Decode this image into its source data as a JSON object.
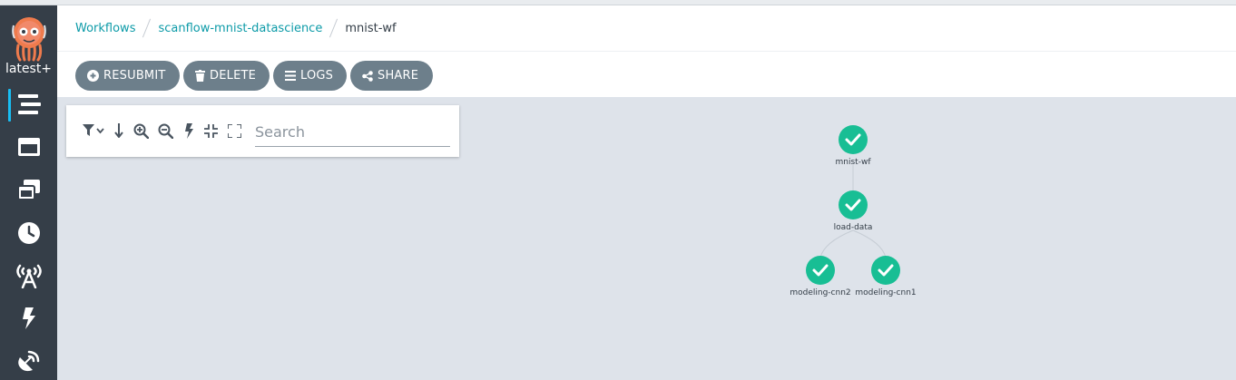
{
  "app": {
    "version": "latest+"
  },
  "sidebar": {
    "items": [
      {
        "name": "workflows",
        "icon": "stream-icon",
        "active": true
      },
      {
        "name": "workflow-templates",
        "icon": "window-maximize-icon"
      },
      {
        "name": "cluster-workflow-templates",
        "icon": "window-restore-icon"
      },
      {
        "name": "cron-workflows",
        "icon": "clock-icon"
      },
      {
        "name": "event-sources",
        "icon": "broadcast-tower-icon"
      },
      {
        "name": "sensors",
        "icon": "bolt-icon"
      },
      {
        "name": "event-flow",
        "icon": "satellite-dish-icon"
      }
    ],
    "accent": "#18bef3"
  },
  "breadcrumb": {
    "items": [
      "Workflows",
      "scanflow-mnist-datascience"
    ],
    "current": "mnist-wf"
  },
  "actions": {
    "resubmit": "RESUBMIT",
    "delete": "DELETE",
    "logs": "LOGS",
    "share": "SHARE"
  },
  "toolbar": {
    "tools": [
      "filter-icon",
      "arrow-down-icon",
      "zoom-in-icon",
      "zoom-out-icon",
      "bolt-icon",
      "compress-icon",
      "expand-icon"
    ],
    "search": {
      "placeholder": "Search",
      "value": ""
    }
  },
  "graph": {
    "nodes": [
      {
        "label": "mnist-wf",
        "status": "succeeded"
      },
      {
        "label": "load-data",
        "status": "succeeded"
      },
      {
        "label": "modeling-cnn2",
        "status": "succeeded"
      },
      {
        "label": "modeling-cnn1",
        "status": "succeeded"
      }
    ],
    "edges": [
      [
        "mnist-wf",
        "load-data"
      ],
      [
        "load-data",
        "modeling-cnn2"
      ],
      [
        "load-data",
        "modeling-cnn1"
      ]
    ],
    "success_color": "#18be94"
  }
}
